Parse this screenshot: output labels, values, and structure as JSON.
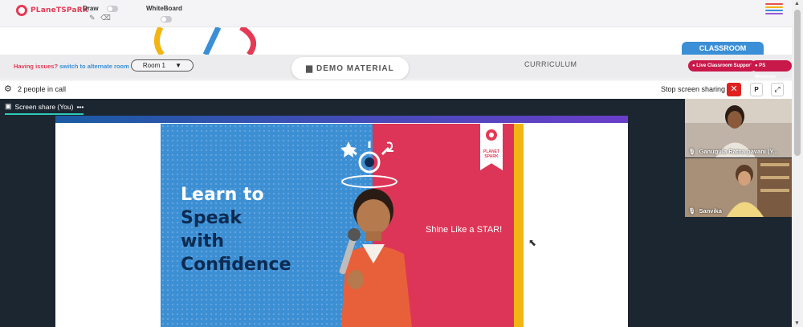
{
  "brand": {
    "logo_text": "PLaneTSPaRK"
  },
  "tools": {
    "draw_label": "Draw",
    "whiteboard_label": "WhiteBoard"
  },
  "menu": {
    "colors": [
      "#e8514e",
      "#f2b514",
      "#3a8fd6",
      "#9a5bd6"
    ]
  },
  "classroom_tab": "CLASSROOM",
  "roombar": {
    "issue_prefix": "Having issues?",
    "issue_link": "switch to alternate room",
    "room_value": "Room 1",
    "demo_material": "DEMO MATERIAL",
    "curriculum": "CURRICULUM",
    "live_support": "Live Classroom Support",
    "ps_moments": "PS Moments"
  },
  "callbar": {
    "people_count": "2 people in call",
    "stop_sharing": "Stop screen sharing",
    "p_button": "P"
  },
  "screen_share": {
    "label": "Screen share (You)",
    "slide": {
      "headline": [
        "Learn to",
        "Speak",
        "with",
        "Confidence"
      ],
      "tagline": "Shine Like a STAR!",
      "badge": "PLANET SPARK"
    }
  },
  "participants": [
    {
      "name": "Ganugula Ratna pavani (Y..."
    },
    {
      "name": "Sanvika"
    }
  ],
  "colors": {
    "accent_red": "#e43a55",
    "accent_blue": "#3a8fd6",
    "share_bg": "#1c2631",
    "stop_red": "#e02020"
  }
}
